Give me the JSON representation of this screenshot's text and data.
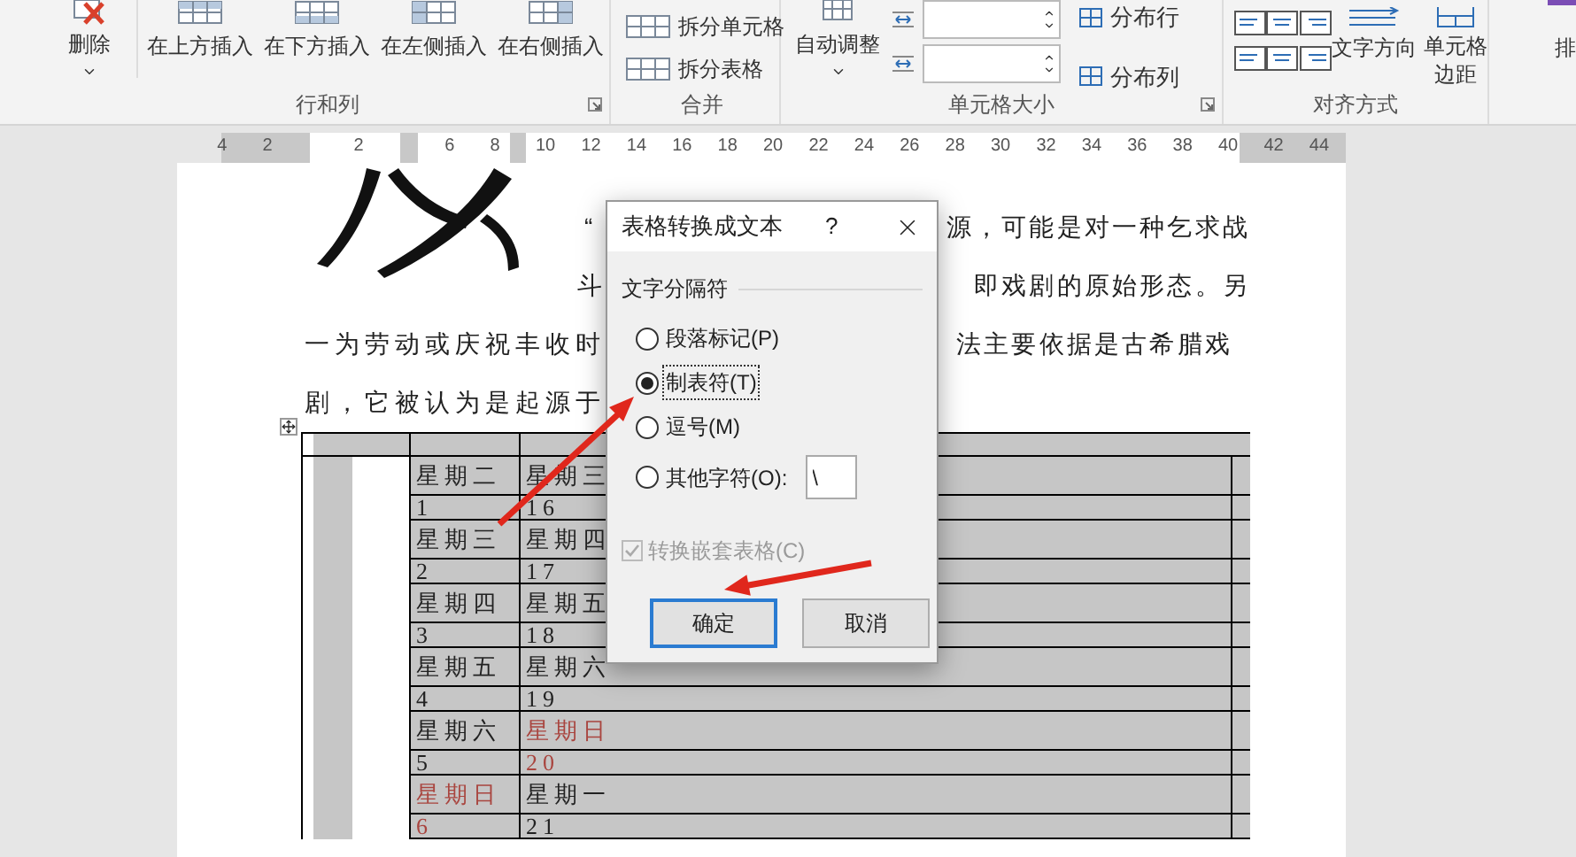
{
  "ribbon": {
    "rows_columns": {
      "label": "行和列",
      "delete": "删除",
      "inserts": [
        "在上方插入",
        "在下方插入",
        "在左侧插入",
        "在右侧插入"
      ]
    },
    "merge": {
      "label": "合并",
      "items": [
        "拆分单元格",
        "拆分表格"
      ]
    },
    "cell_size": {
      "label": "单元格大小",
      "autofit": "自动调整",
      "distribute": [
        "分布行",
        "分布列"
      ]
    },
    "alignment": {
      "label": "对齐方式",
      "text_direction": "文字方向",
      "cell_margins": "单元格边距"
    },
    "sort": "排"
  },
  "ruler": {
    "numbers": [
      "4",
      "2",
      "2",
      "6",
      "8",
      "10",
      "12",
      "14",
      "16",
      "18",
      "20",
      "22",
      "24",
      "26",
      "28",
      "30",
      "32",
      "34",
      "36",
      "38",
      "40",
      "42",
      "44"
    ]
  },
  "document": {
    "lines": [
      {
        "left": "“",
        "right": "源，可能是对一种乞求战"
      },
      {
        "left": "斗",
        "right": "即戏剧的原始形态。另"
      },
      {
        "left": "一为劳动或庆祝丰收时",
        "right": "法主要依据是古希腊戏"
      },
      {
        "left": "剧，它被认为是起源于"
      }
    ]
  },
  "table": {
    "rows": [
      {
        "kind": "label",
        "cells": [
          {
            "text": "星期二",
            "color": "#222222"
          },
          {
            "text": "星期三",
            "color": "#222222"
          }
        ]
      },
      {
        "kind": "number",
        "cells": [
          {
            "text": "1",
            "color": "#222222"
          },
          {
            "text": "16",
            "color": "#222222"
          }
        ]
      },
      {
        "kind": "label",
        "cells": [
          {
            "text": "星期三",
            "color": "#222222"
          },
          {
            "text": "星期四",
            "color": "#222222"
          }
        ]
      },
      {
        "kind": "number",
        "cells": [
          {
            "text": "2",
            "color": "#222222"
          },
          {
            "text": "17",
            "color": "#222222"
          }
        ]
      },
      {
        "kind": "label",
        "cells": [
          {
            "text": "星期四",
            "color": "#222222"
          },
          {
            "text": "星期五",
            "color": "#222222"
          }
        ]
      },
      {
        "kind": "number",
        "cells": [
          {
            "text": "3",
            "color": "#222222"
          },
          {
            "text": "18",
            "color": "#222222"
          }
        ]
      },
      {
        "kind": "label",
        "cells": [
          {
            "text": "星期五",
            "color": "#222222"
          },
          {
            "text": "星期六",
            "color": "#222222"
          }
        ]
      },
      {
        "kind": "number",
        "cells": [
          {
            "text": "4",
            "color": "#222222"
          },
          {
            "text": "19",
            "color": "#222222"
          }
        ]
      },
      {
        "kind": "label",
        "cells": [
          {
            "text": "星期六",
            "color": "#222222"
          },
          {
            "text": "星期日",
            "color": "#a9453f"
          }
        ]
      },
      {
        "kind": "number",
        "cells": [
          {
            "text": "5",
            "color": "#222222"
          },
          {
            "text": "20",
            "color": "#a9453f"
          }
        ]
      },
      {
        "kind": "label",
        "cells": [
          {
            "text": "星期日",
            "color": "#a9453f"
          },
          {
            "text": "星期一",
            "color": "#222222"
          }
        ]
      },
      {
        "kind": "number",
        "cells": [
          {
            "text": "6",
            "color": "#a9453f"
          },
          {
            "text": "21",
            "color": "#222222"
          }
        ]
      }
    ]
  },
  "dialog": {
    "title": "表格转换成文本",
    "help": "?",
    "group": "文字分隔符",
    "options": [
      {
        "label": "段落标记(P)",
        "selected": false,
        "focused": false
      },
      {
        "label": "制表符(T)",
        "selected": true,
        "focused": true
      },
      {
        "label": "逗号(M)",
        "selected": false,
        "focused": false
      },
      {
        "label": "其他字符(O):",
        "selected": false,
        "focused": false,
        "value": "\\"
      }
    ],
    "nested": {
      "label": "转换嵌套表格(C)",
      "checked": true,
      "disabled": true
    },
    "buttons": [
      {
        "label": "确定",
        "focused": true
      },
      {
        "label": "取消",
        "focused": false
      }
    ]
  }
}
